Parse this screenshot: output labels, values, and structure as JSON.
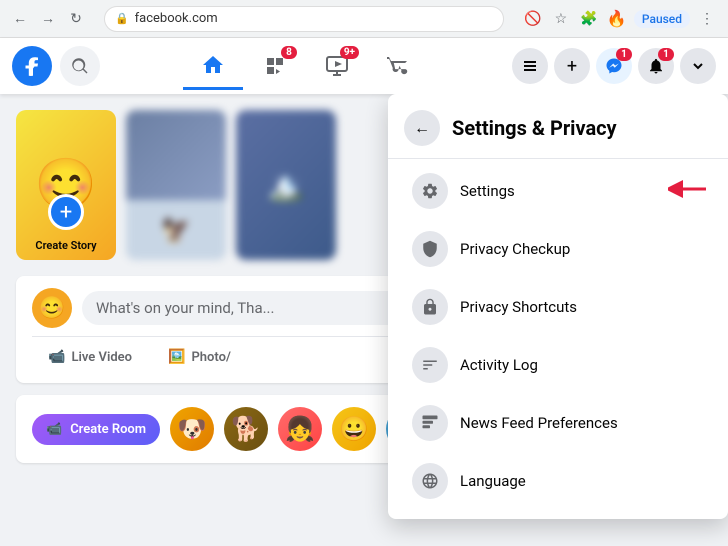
{
  "browser": {
    "back_btn": "←",
    "forward_btn": "→",
    "refresh_btn": "↻",
    "url": "facebook.com",
    "lock_icon": "🔒",
    "star_icon": "☆",
    "puzzle_icon": "🧩",
    "fire_avatar": "🔥",
    "paused_label": "Paused",
    "menu_icon": "⋮"
  },
  "header": {
    "logo_text": "f",
    "search_icon": "🔍",
    "home_icon": "⌂",
    "flag_icon": "⚑",
    "video_icon": "▶",
    "store_icon": "🏪",
    "menu_icon": "☰",
    "plus_icon": "+",
    "messenger_icon": "💬",
    "bell_icon": "🔔",
    "chevron_icon": "▾",
    "flag_badge": "8",
    "video_badge": "9+",
    "bell_badge": "1",
    "messenger_badge": "1"
  },
  "content": {
    "create_story_label": "Create Story",
    "post_placeholder": "What's on your mind, Tha...",
    "live_label": "Live Video",
    "photo_label": "Photo/",
    "create_room_label": "Create Room",
    "nav_arrow": "›"
  },
  "dropdown": {
    "back_icon": "←",
    "title": "Settings & Privacy",
    "items": [
      {
        "id": "settings",
        "icon": "⚙",
        "label": "Settings",
        "has_arrow": true
      },
      {
        "id": "privacy-checkup",
        "icon": "🔒",
        "label": "Privacy Checkup",
        "has_arrow": false
      },
      {
        "id": "privacy-shortcuts",
        "icon": "🔒",
        "label": "Privacy Shortcuts",
        "has_arrow": false
      },
      {
        "id": "activity-log",
        "icon": "≡",
        "label": "Activity Log",
        "has_arrow": false
      },
      {
        "id": "news-feed",
        "icon": "📰",
        "label": "News Feed Preferences",
        "has_arrow": false
      },
      {
        "id": "language",
        "icon": "🌐",
        "label": "Language",
        "has_arrow": false
      }
    ]
  }
}
